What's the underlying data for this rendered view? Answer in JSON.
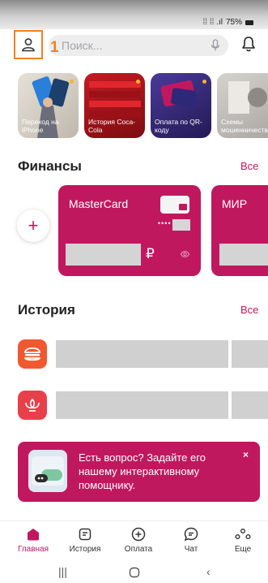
{
  "status_bar": {
    "battery": "75%"
  },
  "header": {
    "annotation_number": "1",
    "search_placeholder": "Поиск..."
  },
  "stories": [
    {
      "label": "Переход на iPhone",
      "bg": "#d8d4cc"
    },
    {
      "label": "История Coca-Cola",
      "bg": "#b3161e"
    },
    {
      "label": "Оплата по QR-коду",
      "bg": "#3a2a7a"
    },
    {
      "label": "Схемы мошенничества",
      "bg": "#c8c6c2"
    }
  ],
  "finance": {
    "title": "Финансы",
    "all_link": "Все",
    "add_symbol": "+",
    "cards": [
      {
        "name": "MasterCard",
        "mask": "••••",
        "currency": "₽"
      },
      {
        "name": "МИР"
      }
    ]
  },
  "history": {
    "title": "История",
    "all_link": "Все",
    "items": [
      {
        "icon": "burger-icon",
        "color": "#f0582f"
      },
      {
        "icon": "lotus-icon",
        "color": "#e8404a"
      }
    ]
  },
  "banner": {
    "text": "Есть вопрос? Задайте его нашему интерактивному помощнику.",
    "close": "×"
  },
  "tabs": [
    {
      "label": "Главная",
      "icon": "home-icon",
      "active": true
    },
    {
      "label": "История",
      "icon": "history-icon",
      "active": false
    },
    {
      "label": "Оплата",
      "icon": "payment-icon",
      "active": false
    },
    {
      "label": "Чат",
      "icon": "chat-icon",
      "active": false
    },
    {
      "label": "Еще",
      "icon": "more-icon",
      "active": false
    }
  ],
  "colors": {
    "brand": "#c0185f",
    "annotation": "#f0821e"
  }
}
